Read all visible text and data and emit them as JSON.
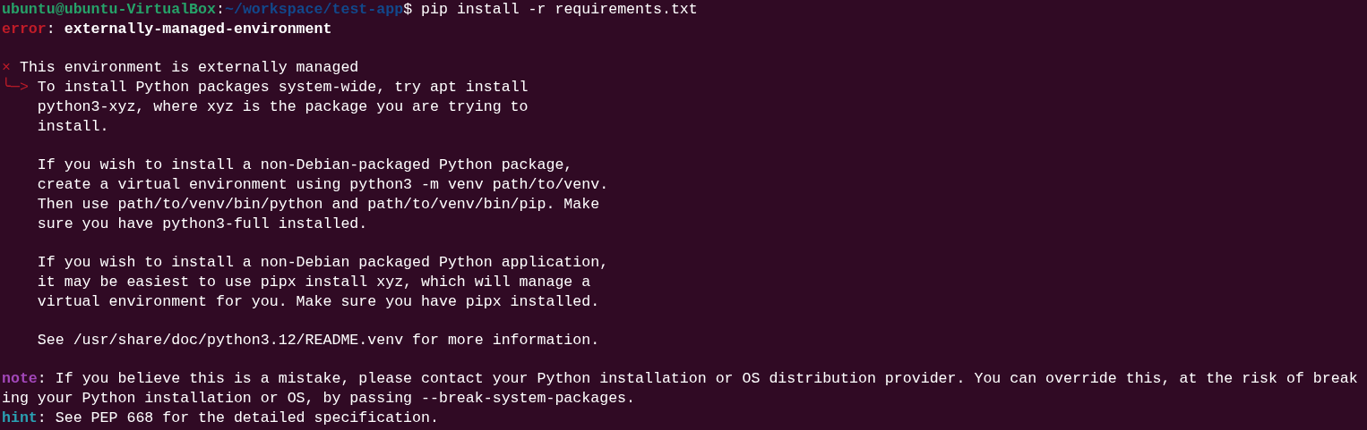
{
  "terminal": {
    "blocks": [
      {
        "lines": [
          [
            {
              "kind": "user",
              "text": "ubuntu@ubuntu-VirtualBox"
            },
            {
              "kind": "plain",
              "text": ":"
            },
            {
              "kind": "path",
              "text": "~/workspace/test-app"
            },
            {
              "kind": "plain",
              "text": "$ pip install -r requirements.txt"
            }
          ],
          [
            {
              "kind": "error",
              "text": "error"
            },
            {
              "kind": "plain",
              "text": ": "
            },
            {
              "kind": "bold",
              "text": "externally-managed-environment"
            }
          ]
        ]
      },
      {
        "lines": [
          [
            {
              "kind": "mark",
              "text": "×"
            },
            {
              "kind": "plain",
              "text": " This environment is externally managed"
            }
          ],
          [
            {
              "kind": "mark",
              "text": "╰─>"
            },
            {
              "kind": "plain",
              "text": " To install Python packages system-wide, try apt install"
            }
          ],
          [
            {
              "kind": "plain",
              "text": "    python3-xyz, where xyz is the package you are trying to"
            }
          ],
          [
            {
              "kind": "plain",
              "text": "    install."
            }
          ]
        ]
      },
      {
        "lines": [
          [
            {
              "kind": "plain",
              "text": "    If you wish to install a non-Debian-packaged Python package,"
            }
          ],
          [
            {
              "kind": "plain",
              "text": "    create a virtual environment using python3 -m venv path/to/venv."
            }
          ],
          [
            {
              "kind": "plain",
              "text": "    Then use path/to/venv/bin/python and path/to/venv/bin/pip. Make"
            }
          ],
          [
            {
              "kind": "plain",
              "text": "    sure you have python3-full installed."
            }
          ]
        ]
      },
      {
        "lines": [
          [
            {
              "kind": "plain",
              "text": "    If you wish to install a non-Debian packaged Python application,"
            }
          ],
          [
            {
              "kind": "plain",
              "text": "    it may be easiest to use pipx install xyz, which will manage a"
            }
          ],
          [
            {
              "kind": "plain",
              "text": "    virtual environment for you. Make sure you have pipx installed."
            }
          ]
        ]
      },
      {
        "lines": [
          [
            {
              "kind": "plain",
              "text": "    See /usr/share/doc/python3.12/README.venv for more information."
            }
          ]
        ]
      },
      {
        "lines": [
          [
            {
              "kind": "note",
              "text": "note"
            },
            {
              "kind": "plain",
              "text": ": If you believe this is a mistake, please contact your Python installation or OS distribution provider. You can override this, at the risk of break"
            }
          ],
          [
            {
              "kind": "plain",
              "text": "ing your Python installation or OS, by passing --break-system-packages."
            }
          ],
          [
            {
              "kind": "hint",
              "text": "hint"
            },
            {
              "kind": "plain",
              "text": ": See PEP 668 for the detailed specification."
            }
          ]
        ]
      }
    ]
  }
}
